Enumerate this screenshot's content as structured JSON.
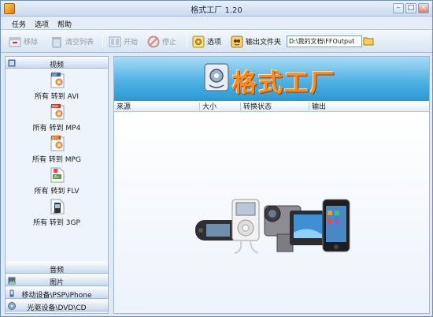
{
  "window": {
    "title": "格式工厂 1.20",
    "buttons": {
      "minimize": "–",
      "maximize": "□",
      "close": "×"
    }
  },
  "menu": {
    "items": [
      "任务",
      "选项",
      "帮助"
    ]
  },
  "toolbar": {
    "remove_label": "移除",
    "clear_list_label": "清空列表",
    "start_label": "开始",
    "stop_label": "停止",
    "options_label": "选项",
    "output_folder_label": "输出文件夹",
    "output_path": "D:\\我的文档\\FFOutput"
  },
  "sidebar": {
    "video_header": "视频",
    "video_formats": [
      {
        "label": "所有 转到 AVI",
        "badge": "AVI"
      },
      {
        "label": "所有 转到 MP4",
        "badge": "MP4"
      },
      {
        "label": "所有 转到 MPG",
        "badge": "MPG"
      },
      {
        "label": "所有 转到 FLV",
        "badge": "flv"
      },
      {
        "label": "所有 转到 3GP",
        "badge": "3GP"
      }
    ],
    "categories": [
      "音频",
      "图片",
      "移动设备\\PSP\\iPhone",
      "光驱设备\\DVD\\CD"
    ]
  },
  "main": {
    "banner_title": "格式工厂",
    "columns": [
      "来源",
      "大小",
      "转换状态",
      "输出"
    ]
  },
  "colors": {
    "banner_text": "#ff8a1a",
    "banner_bg": "#4fb2e4",
    "window_bg": "#dfeaf6"
  }
}
